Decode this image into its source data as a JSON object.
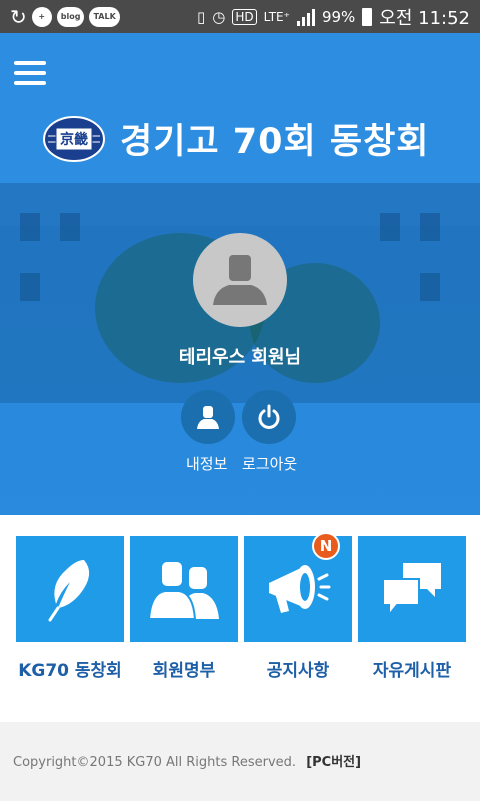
{
  "status_bar": {
    "left_icons": [
      "sync-icon",
      "add-icon",
      "blog",
      "TALK"
    ],
    "network_hd": "HD",
    "network_lte": "LTE⁺",
    "battery": "99%",
    "time": "오전 11:52"
  },
  "header": {
    "title": "경기고 70회 동창회",
    "emblem_text": "京畿"
  },
  "profile": {
    "name": "테리우스 회원님",
    "my_info_label": "내정보",
    "logout_label": "로그아웃"
  },
  "tiles": [
    {
      "label": "KG70 동창회",
      "icon": "feather-icon"
    },
    {
      "label": "회원명부",
      "icon": "people-icon"
    },
    {
      "label": "공지사항",
      "icon": "megaphone-icon",
      "badge": "N"
    },
    {
      "label": "자유게시판",
      "icon": "chat-icon"
    }
  ],
  "footer": {
    "copyright": "Copyright©2015 KG70 All Rights Reserved.",
    "pc_link": "[PC버전]"
  },
  "colors": {
    "hero_blue": "#2891eb",
    "tile_blue": "#1f9be8",
    "label_blue": "#1e5fa8",
    "badge_orange": "#e85c1d"
  }
}
